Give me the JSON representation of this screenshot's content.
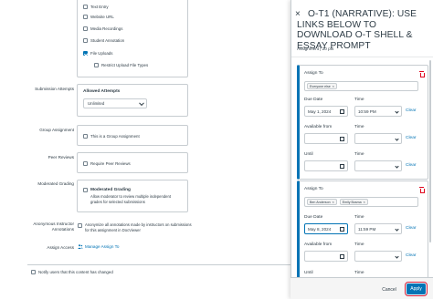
{
  "submission_types": [
    {
      "label": "Text Entry",
      "checked": false
    },
    {
      "label": "Website URL",
      "checked": false
    },
    {
      "label": "Media Recordings",
      "checked": false
    },
    {
      "label": "Student Annotation",
      "checked": false
    },
    {
      "label": "File Uploads",
      "checked": true
    },
    {
      "label": "Restrict Upload File Types",
      "checked": false
    }
  ],
  "submission_attempts": {
    "label": "Submission Attempts",
    "heading": "Allowed Attempts",
    "value": "Unlimited"
  },
  "group_assignment": {
    "label": "Group Assignment",
    "option": "This is a Group Assignment"
  },
  "peer_reviews": {
    "label": "Peer Reviews",
    "option": "Require Peer Reviews"
  },
  "moderated_grading": {
    "label": "Moderated Grading",
    "option": "Moderated Grading",
    "description": "Allow moderator to review multiple independent grades for selected submissions"
  },
  "anonymous": {
    "label": "Anonymous Instructor Annotations",
    "option": "Anonymize all annotations made by instructors on submissions for this assignment in DocViewer"
  },
  "assign_access": {
    "label": "Assign Access",
    "link": "Manage Assign To"
  },
  "notify": "Notify users that this content has changed",
  "tray": {
    "close": "×",
    "title": "O-T1 (NARRATIVE): USE LINKS BELOW TO DOWNLOAD O-T SHELL & ESSAY PROMPT",
    "subtitle": "Assignment | 20 pts",
    "labels": {
      "assign_to": "Assign To",
      "due_date": "Due Date",
      "time": "Time",
      "available_from": "Available from",
      "until": "Until",
      "clear": "Clear"
    },
    "cards": [
      {
        "assignees": [
          "Everyone else"
        ],
        "due_date": "May 1, 2024",
        "due_time": "10:59 PM"
      },
      {
        "assignees": [
          "Ben Anderson",
          "Emily Bosma"
        ],
        "due_date": "May 8, 2024",
        "due_time": "11:59 PM"
      }
    ]
  },
  "footer": {
    "cancel": "Cancel",
    "apply": "Apply"
  },
  "colors": {
    "accent": "#0374b5",
    "danger": "#e0061f",
    "focus_ring": "#d6203b"
  }
}
